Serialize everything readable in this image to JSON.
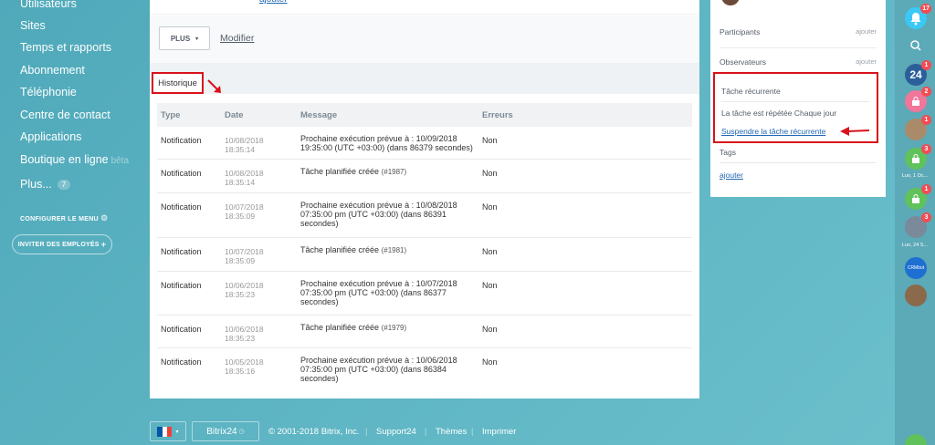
{
  "left_menu": {
    "items": [
      {
        "label": "Utilisateurs"
      },
      {
        "label": "Sites"
      },
      {
        "label": "Temps et rapports"
      },
      {
        "label": "Abonnement"
      },
      {
        "label": "Téléphonie"
      },
      {
        "label": "Centre de contact"
      },
      {
        "label": "Applications"
      },
      {
        "label": "Boutique en ligne",
        "suffix": "bêta"
      },
      {
        "label": "Plus...",
        "count": "7"
      }
    ],
    "configure_label": "CONFIGURER LE MENU",
    "invite_label": "INVITER DES EMPLOYÉS"
  },
  "toolbar": {
    "top_cut_link": "ajouter",
    "plus_label": "PLUS",
    "modify_label": "Modifier"
  },
  "history": {
    "tab_label": "Historique",
    "columns": [
      "Type",
      "Date",
      "Message",
      "Erreurs"
    ],
    "rows": [
      {
        "type": "Notification",
        "date1": "10/08/2018",
        "date2": "18:35:14",
        "msg": "Prochaine exécution prévue à :   10/09/2018 19:35:00 (UTC +03:00)  (dans 86379 secondes)",
        "err": "Non"
      },
      {
        "type": "Notification",
        "date1": "10/08/2018",
        "date2": "18:35:14",
        "msg": "Tâche planifiée créée",
        "msg_small": "(#1987)",
        "err": "Non"
      },
      {
        "type": "Notification",
        "date1": "10/07/2018",
        "date2": "18:35:09",
        "msg": "Prochaine exécution prévue à :   10/08/2018 07:35:00 pm (UTC +03:00)  (dans 86391 secondes)",
        "err": "Non"
      },
      {
        "type": "Notification",
        "date1": "10/07/2018",
        "date2": "18:35:09",
        "msg": "Tâche planifiée créée",
        "msg_small": "(#1981)",
        "err": "Non"
      },
      {
        "type": "Notification",
        "date1": "10/06/2018",
        "date2": "18:35:23",
        "msg": "Prochaine exécution prévue à :   10/07/2018 07:35:00 pm (UTC +03:00)  (dans 86377 secondes)",
        "err": "Non"
      },
      {
        "type": "Notification",
        "date1": "10/06/2018",
        "date2": "18:35:23",
        "msg": "Tâche planifiée créée",
        "msg_small": "(#1979)",
        "err": "Non"
      },
      {
        "type": "Notification",
        "date1": "10/05/2018",
        "date2": "18:35:16",
        "msg": "Prochaine exécution prévue à :   10/06/2018 07:35:00 pm (UTC +03:00)  (dans 86384 secondes)",
        "err": "Non"
      }
    ]
  },
  "right_panel": {
    "participants_label": "Participants",
    "participants_add": "ajouter",
    "observers_label": "Observateurs",
    "observers_add": "ajouter",
    "recurring_title": "Tâche récurrente",
    "recurring_desc": "La tâche est répétée Chaque jour",
    "recurring_link": "Suspendre la tâche récurrente",
    "tags_label": "Tags",
    "tags_add": "ajouter"
  },
  "dock": {
    "notifications_count": "17",
    "badges": [
      "1",
      "2",
      "1",
      "3",
      "1",
      "3"
    ],
    "date_label_1": "Lun, 1 Oc...",
    "date_label_2": "Lun, 24 S...",
    "crm_label": "CRMbot",
    "b24_text": "24"
  },
  "footer": {
    "brand": "Bitrix24",
    "copyright": "© 2001-2018 Bitrix, Inc.",
    "links": [
      "Support24",
      "Thèmes",
      "Imprimer"
    ]
  },
  "colors": {
    "background": "#5fb3c2",
    "highlight_red": "#d9121b",
    "link_blue": "#2067b0",
    "badge_red": "#f24c52"
  }
}
